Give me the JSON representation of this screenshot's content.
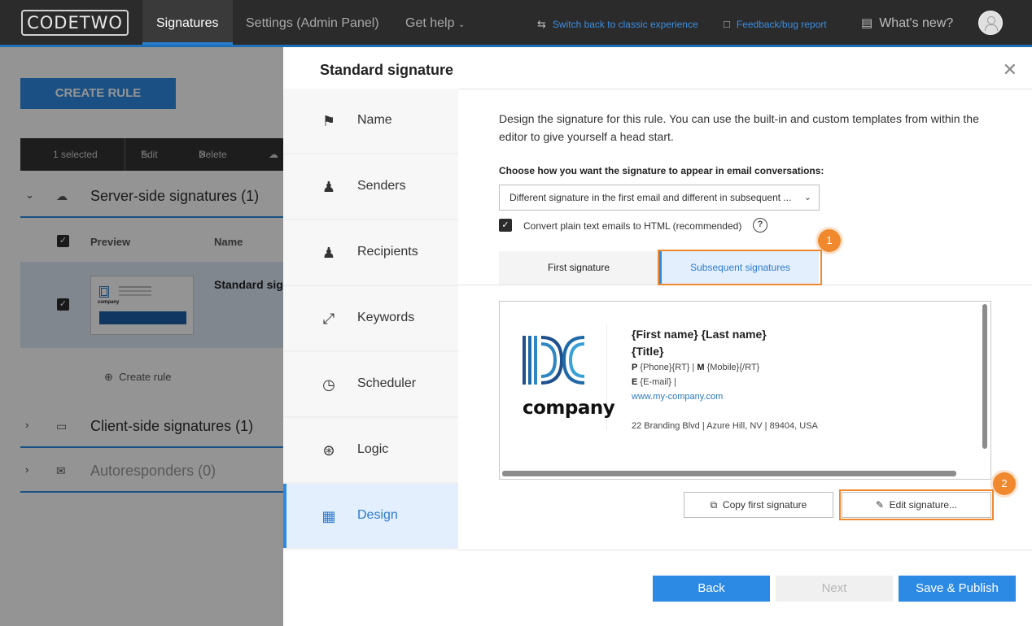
{
  "app": {
    "logo": "CODETWO",
    "nav": [
      "Signatures",
      "Settings (Admin Panel)",
      "Get help"
    ],
    "links": {
      "switch_classic": "Switch back to classic experience",
      "feedback": "Feedback/bug report",
      "whats_new": "What's new?"
    }
  },
  "background": {
    "create_rule": "CREATE RULE",
    "toolbar": {
      "selected": "1 selected",
      "edit": "Edit",
      "delete": "Delete"
    },
    "sections": [
      {
        "label": "Server-side signatures (1)"
      },
      {
        "label": "Client-side signatures (1)"
      },
      {
        "label": "Autoresponders (0)"
      }
    ],
    "columns": {
      "preview": "Preview",
      "name": "Name"
    },
    "rule_name": "Standard sig",
    "create_rule_link": "Create rule"
  },
  "modal": {
    "title": "Standard signature",
    "steps": [
      "Name",
      "Senders",
      "Recipients",
      "Keywords",
      "Scheduler",
      "Logic",
      "Design"
    ],
    "intro": "Design the signature for this rule. You can use the built-in and custom templates from within the editor to give yourself a head start.",
    "choose_label": "Choose how you want the signature to appear in email conversations:",
    "select_value": "Different signature in the first email and different in subsequent ...",
    "convert_checkbox": "Convert plain text emails to HTML (recommended)",
    "tabs": {
      "first": "First signature",
      "subsequent": "Subsequent signatures"
    },
    "badges": {
      "one": "1",
      "two": "2"
    },
    "signature": {
      "company": "company",
      "name_line": "{First name} {Last name}",
      "title_line": "{Title}",
      "p_label": "P",
      "phone": "{Phone}{RT}",
      "m_label": "M",
      "mobile": "{Mobile}{/RT}",
      "e_label": "E",
      "email": "{E-mail}",
      "website": "www.my-company.com",
      "address": "22 Branding Blvd | Azure Hill, NV | 89404, USA"
    },
    "buttons": {
      "copy_first": "Copy first signature",
      "edit_signature": "Edit signature...",
      "back": "Back",
      "next": "Next",
      "save_publish": "Save & Publish"
    }
  }
}
